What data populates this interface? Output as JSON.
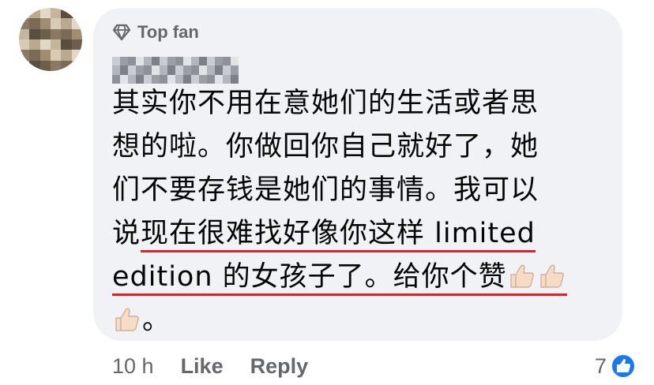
{
  "badge": {
    "label": "Top fan",
    "icon": "diamond-icon"
  },
  "author": {
    "name_redacted": true
  },
  "comment": {
    "line1": "其实你不用在意她们的生活或者思",
    "line2": "想的啦。你做回你自己就好了，她",
    "line3": "们不要存钱是她们的事情。我可以",
    "line4_plain": "说",
    "line4_underlined": "现在很难找好像你这样 limited",
    "line5_underlined": "edition 的女孩子了。给你个赞",
    "line6_text": "。",
    "emoji": "thumbs-up-light-skin-icon",
    "underline_color": "#e0202a"
  },
  "actions": {
    "time": "10 h",
    "like": "Like",
    "reply": "Reply"
  },
  "reactions": {
    "count": "7",
    "icon": "like-reaction-icon",
    "color": "#1877f2"
  }
}
